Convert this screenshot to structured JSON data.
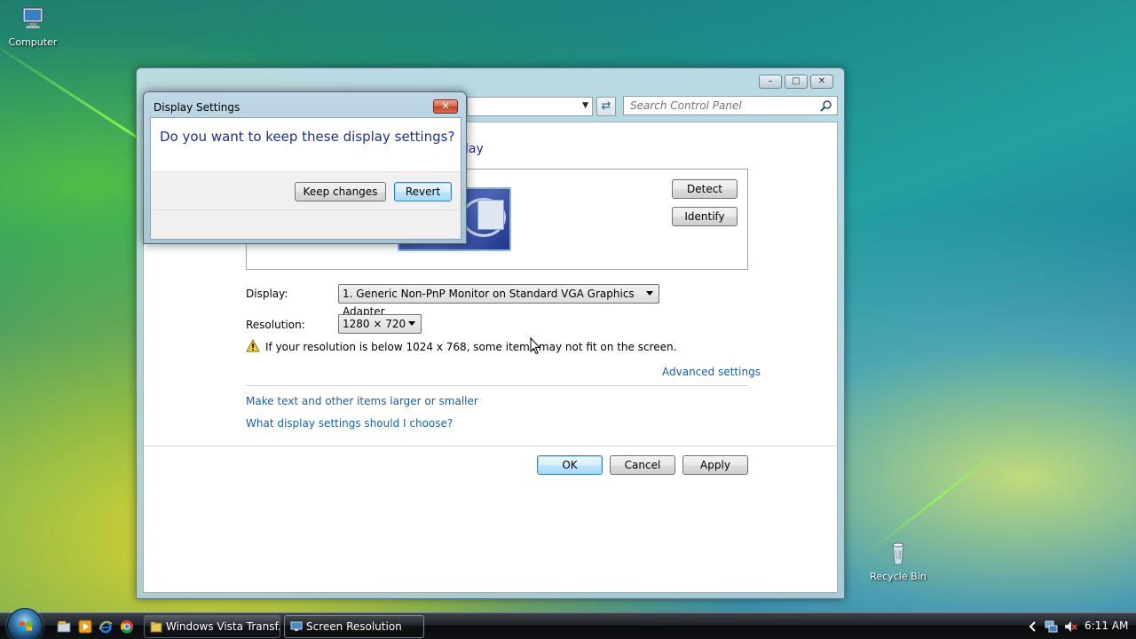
{
  "desktop": {
    "icons": [
      {
        "label": "Computer",
        "icon": "computer-icon"
      },
      {
        "label": "Recycle Bin",
        "icon": "recycle-bin-icon"
      }
    ]
  },
  "control_panel": {
    "search_placeholder": "Search Control Panel",
    "heading_partial": "lay",
    "detect_label": "Detect",
    "identify_label": "Identify",
    "display_label": "Display:",
    "display_value": "1. Generic Non-PnP Monitor on Standard VGA Graphics Adapter",
    "resolution_label": "Resolution:",
    "resolution_value": "1280 × 720",
    "warning_text": "If your resolution is below 1024 x 768, some items may not fit on the screen.",
    "advanced_link": "Advanced settings",
    "links": [
      "Make text and other items larger or smaller",
      "What display settings should I choose?"
    ],
    "ok_label": "OK",
    "cancel_label": "Cancel",
    "apply_label": "Apply"
  },
  "dialog": {
    "title": "Display Settings",
    "question": "Do you want to keep these display settings?",
    "keep_label": "Keep changes",
    "revert_label": "Revert"
  },
  "taskbar": {
    "buttons": [
      {
        "label": "Windows Vista Transf...",
        "icon": "folder-icon",
        "active": false
      },
      {
        "label": "Screen Resolution",
        "icon": "display-icon",
        "active": true
      }
    ],
    "clock": "6:11 AM"
  },
  "colors": {
    "heading": "#1e3287",
    "link": "#1a5ea8"
  }
}
